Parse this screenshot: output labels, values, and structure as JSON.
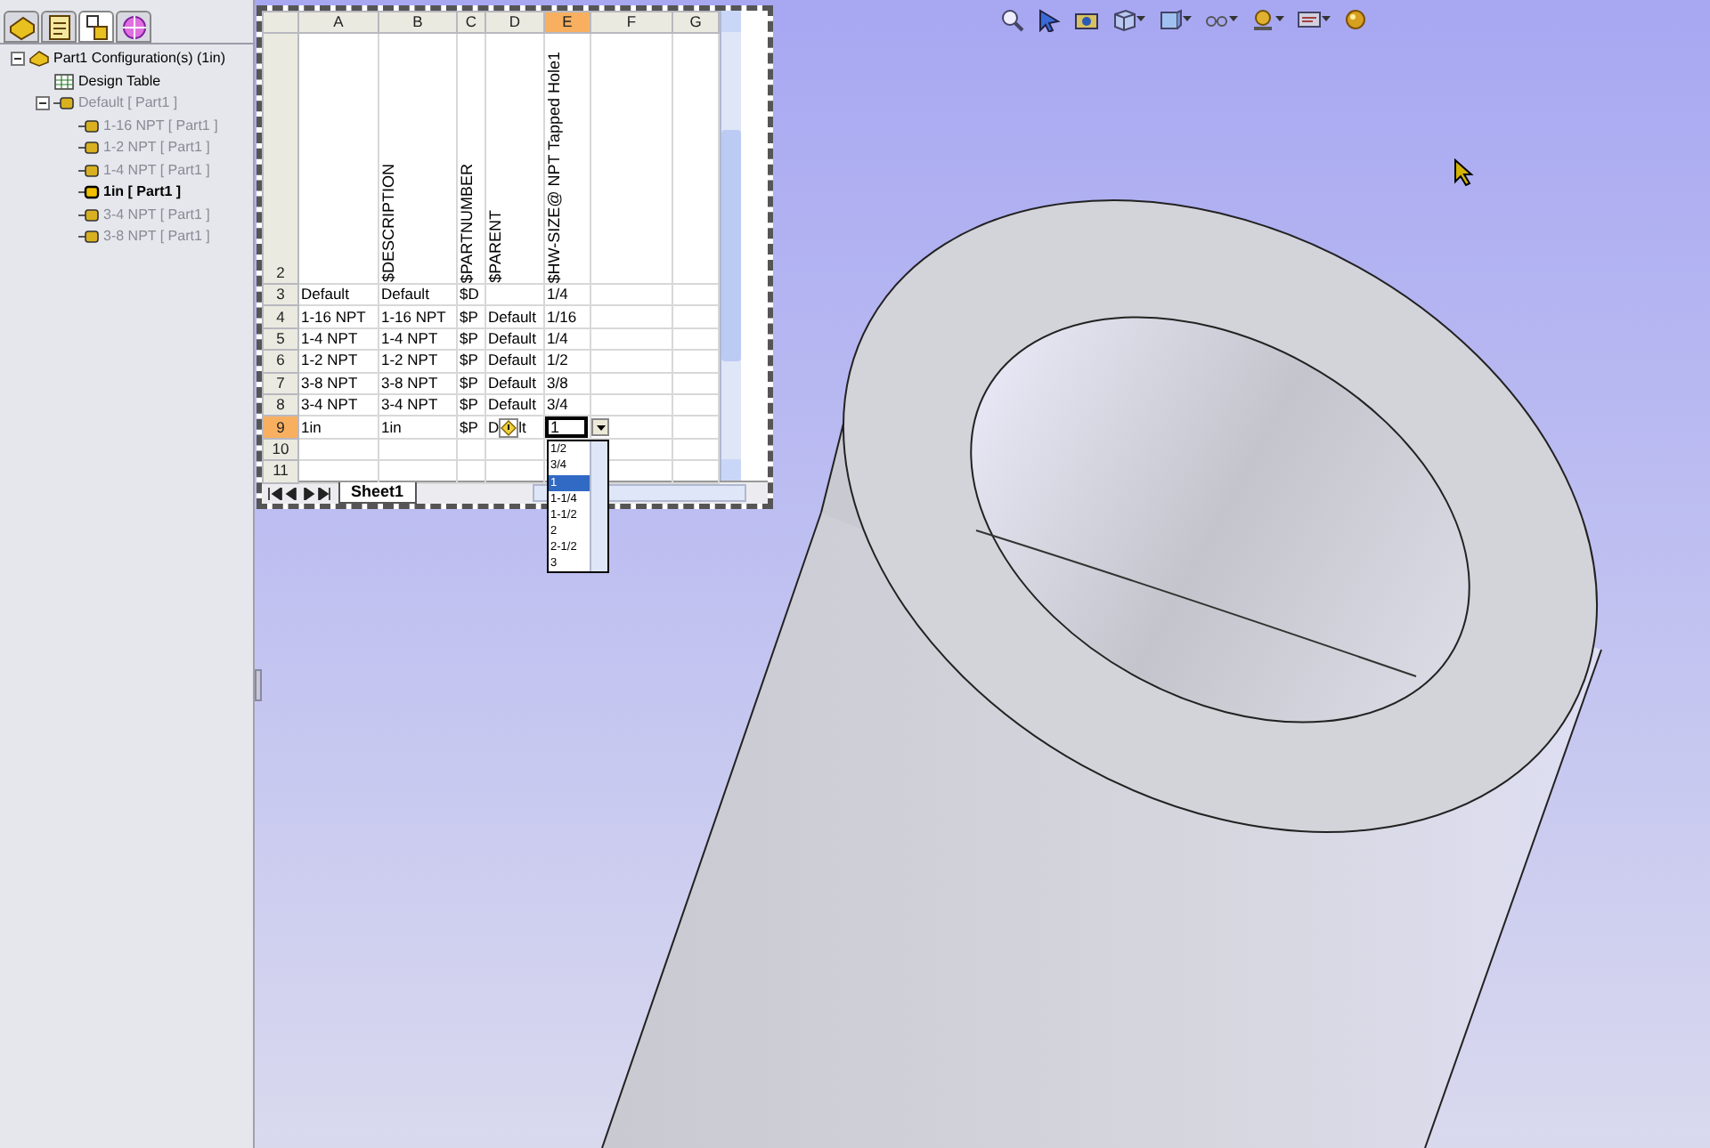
{
  "panel_tabs": [
    {
      "kind": "part",
      "selected": false
    },
    {
      "kind": "properties",
      "selected": false
    },
    {
      "kind": "configurations",
      "selected": true
    },
    {
      "kind": "target",
      "selected": false
    }
  ],
  "tree": [
    {
      "kind": "root",
      "label": "Part1 Configuration(s) (1in)",
      "expanded": true,
      "children": [
        {
          "kind": "table",
          "label": "Design Table"
        },
        {
          "kind": "config",
          "label": "Default [ Part1 ]",
          "active": false,
          "expanded": true,
          "children": [
            {
              "kind": "config",
              "label": "1-16 NPT [ Part1 ]",
              "active": false
            },
            {
              "kind": "config",
              "label": "1-2 NPT [ Part1 ]",
              "active": false
            },
            {
              "kind": "config",
              "label": "1-4 NPT [ Part1 ]",
              "active": false
            },
            {
              "kind": "config",
              "label": "1in [ Part1 ]",
              "active": true
            },
            {
              "kind": "config",
              "label": "3-4 NPT [ Part1 ]",
              "active": false
            },
            {
              "kind": "config",
              "label": "3-8 NPT [ Part1 ]",
              "active": false
            }
          ]
        }
      ]
    }
  ],
  "toolbar": [
    {
      "kind": "zoom"
    },
    {
      "kind": "arrow"
    },
    {
      "kind": "camera"
    },
    {
      "kind": "box"
    },
    {
      "kind": "cube"
    },
    {
      "kind": "glasses"
    },
    {
      "kind": "lights"
    },
    {
      "kind": "display"
    },
    {
      "kind": "sphere"
    }
  ],
  "spreadsheet": {
    "columns": [
      {
        "label": "A",
        "selected": false
      },
      {
        "label": "B",
        "selected": false
      },
      {
        "label": "C",
        "selected": false
      },
      {
        "label": "D",
        "selected": false
      },
      {
        "label": "E",
        "selected": true
      },
      {
        "label": "F",
        "selected": false
      },
      {
        "label": "G",
        "selected": false
      }
    ],
    "header_row": {
      "number": "2",
      "selected": false,
      "cells": [
        "",
        "$DESCRIPTION",
        "$PARTNUMBER",
        "$PARENT",
        "$HW-SIZE@ NPT Tapped Hole1",
        "",
        ""
      ]
    },
    "rows": [
      {
        "number": "3",
        "selected": false,
        "cells": [
          "Default",
          "Default",
          "$D",
          "",
          "1/4",
          "",
          ""
        ]
      },
      {
        "number": "4",
        "selected": false,
        "cells": [
          "1-16 NPT",
          "1-16 NPT",
          "$P",
          "Default",
          "1/16",
          "",
          ""
        ]
      },
      {
        "number": "5",
        "selected": false,
        "cells": [
          "1-4 NPT",
          "1-4 NPT",
          "$P",
          "Default",
          "1/4",
          "",
          ""
        ]
      },
      {
        "number": "6",
        "selected": false,
        "cells": [
          "1-2 NPT",
          "1-2 NPT",
          "$P",
          "Default",
          "1/2",
          "",
          ""
        ]
      },
      {
        "number": "7",
        "selected": false,
        "cells": [
          "3-8 NPT",
          "3-8 NPT",
          "$P",
          "Default",
          "3/8",
          "",
          ""
        ]
      },
      {
        "number": "8",
        "selected": false,
        "cells": [
          "3-4 NPT",
          "3-4 NPT",
          "$P",
          "Default",
          "3/4",
          "",
          ""
        ]
      },
      {
        "number": "9",
        "selected": true,
        "cells": [
          "1in",
          "1in",
          "$P",
          {
            "kind": "covered",
            "before": "D",
            "after": "lt"
          },
          {
            "kind": "dropdown",
            "value": "1"
          },
          "",
          ""
        ]
      },
      {
        "number": "10",
        "selected": false,
        "cells": [
          "",
          "",
          "",
          "",
          "",
          "",
          ""
        ]
      },
      {
        "number": "11",
        "selected": false,
        "cells": [
          "",
          "",
          "",
          "",
          "",
          "",
          ""
        ]
      }
    ],
    "dropdown_options": [
      {
        "label": "1/2",
        "selected": false
      },
      {
        "label": "3/4",
        "selected": false
      },
      {
        "label": "1",
        "selected": true
      },
      {
        "label": "1-1/4",
        "selected": false
      },
      {
        "label": "1-1/2",
        "selected": false
      },
      {
        "label": "2",
        "selected": false
      },
      {
        "label": "2-1/2",
        "selected": false
      },
      {
        "label": "3",
        "selected": false
      }
    ],
    "sheet_tabs": [
      {
        "label": "Sheet1",
        "selected": true
      }
    ]
  }
}
